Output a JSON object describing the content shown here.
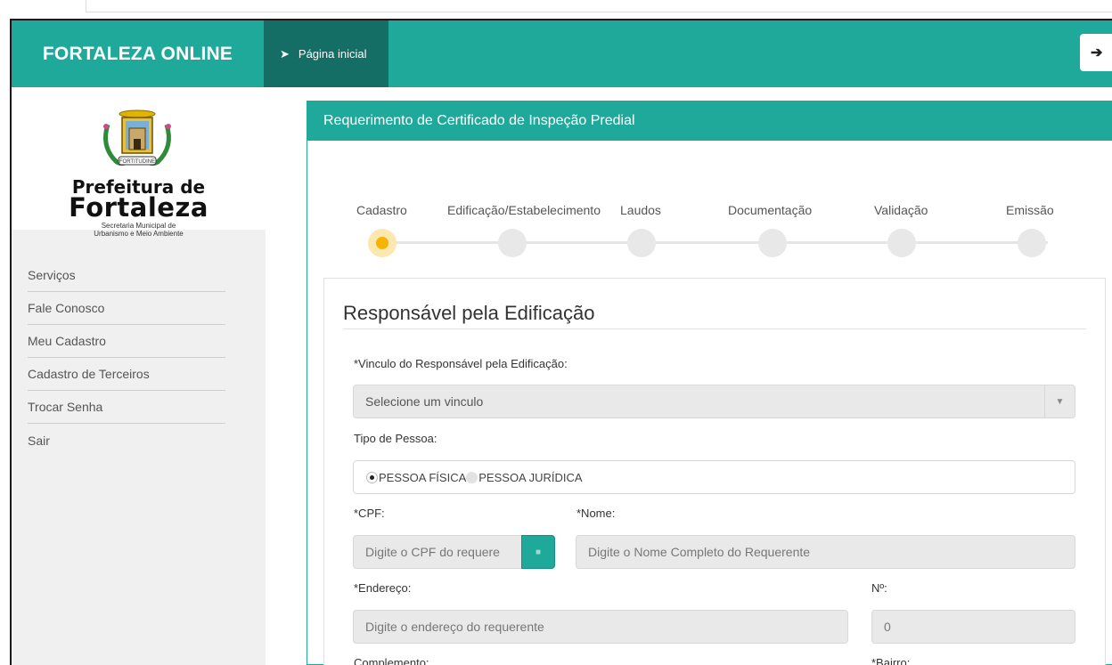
{
  "header": {
    "brand": "FORTALEZA ONLINE",
    "nav_home": "Página inicial",
    "exit_icon": "arrow-right-icon",
    "exit_glyph": "➔"
  },
  "sidebar": {
    "logo": {
      "line1": "Prefeitura de",
      "line2": "Fortaleza",
      "line3": "Secretaria Municipal de",
      "line4": "Urbanismo e Meio Ambiente",
      "crest_motto": "FORTITUDINE"
    },
    "items": [
      {
        "label": "Serviços"
      },
      {
        "label": "Fale Conosco"
      },
      {
        "label": "Meu Cadastro"
      },
      {
        "label": "Cadastro de Terceiros"
      },
      {
        "label": "Trocar Senha"
      },
      {
        "label": "Sair"
      }
    ]
  },
  "panel": {
    "title": "Requerimento de Certificado de Inspeção Predial"
  },
  "steps": [
    {
      "label": "Cadastro",
      "active": true
    },
    {
      "label": "Edificação/Estabelecimento",
      "active": false
    },
    {
      "label": "Laudos",
      "active": false
    },
    {
      "label": "Documentação",
      "active": false
    },
    {
      "label": "Validação",
      "active": false
    },
    {
      "label": "Emissão",
      "active": false
    }
  ],
  "form": {
    "section_title": "Responsável pela Edificação",
    "vinculo_label": "*Vinculo do Responsável pela Edificação:",
    "vinculo_value": "Selecione um vinculo",
    "tipo_label": "Tipo de Pessoa:",
    "tipo_options": [
      "PESSOA FÍSICA",
      "PESSOA JURÍDICA"
    ],
    "tipo_selected": "PESSOA FÍSICA",
    "cpf_label": "*CPF:",
    "cpf_placeholder": "Digite o CPF do requere",
    "nome_label": "*Nome:",
    "nome_placeholder": "Digite o Nome Completo do Requerente",
    "endereco_label": "*Endereço:",
    "endereco_placeholder": "Digite o endereço do requerente",
    "numero_label": "Nº:",
    "numero_value": "0",
    "complemento_label": "Complemento:",
    "bairro_label": "*Bairro:"
  },
  "colors": {
    "accent": "#1fa99b",
    "accent_dark": "#146e66",
    "step_active": "#f5b400"
  }
}
